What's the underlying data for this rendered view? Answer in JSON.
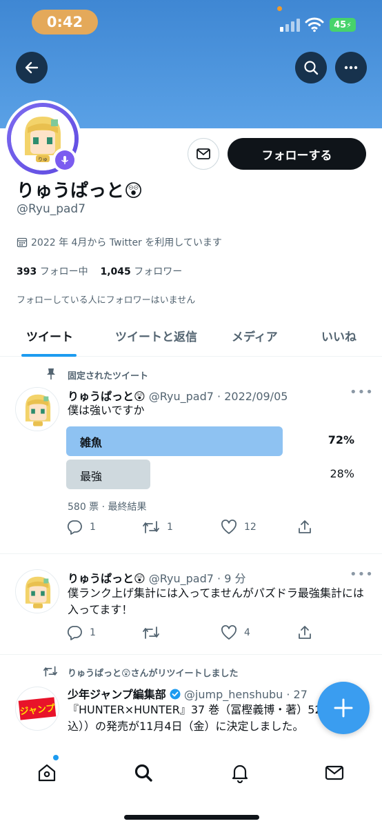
{
  "status": {
    "time": "0:42",
    "battery": "45"
  },
  "profile": {
    "display_name": "りゅうぱっと",
    "name_emoji": "😲",
    "handle": "@Ryu_pad7",
    "joined": "2022 年 4月から Twitter を利用しています",
    "following_count": "393",
    "following_label": "フォロー中",
    "followers_count": "1,045",
    "followers_label": "フォロワー",
    "followers_known": "フォローしている人にフォロワーはいません",
    "follow_label": "フォローする"
  },
  "tabs": [
    {
      "label": "ツイート"
    },
    {
      "label": "ツイートと返信"
    },
    {
      "label": "メディア"
    },
    {
      "label": "いいね"
    }
  ],
  "tweets": [
    {
      "context": "固定されたツイート",
      "name": "りゅうぱっと",
      "emoji": "😲",
      "handle": "@Ryu_pad7 · 2022/09/05",
      "text": "僕は強いですか",
      "poll": {
        "options": [
          {
            "label": "雑魚",
            "percent": "72%",
            "share": 72
          },
          {
            "label": "最強",
            "percent": "28%",
            "share": 28
          }
        ],
        "meta": "580 票 · 最終結果"
      },
      "replies": "1",
      "retweets": "1",
      "likes": "12"
    },
    {
      "name": "りゅうぱっと",
      "emoji": "😲",
      "handle": "@Ryu_pad7 · 9 分",
      "text": "僕ランク上げ集計には入ってませんがパズドラ最強集計には入ってます！",
      "replies": "1",
      "retweets": "",
      "likes": "4"
    },
    {
      "context": "りゅうぱっと😲さんがリツイートしました",
      "name": "少年ジャンプ編集部",
      "handle": "@jump_henshubu · 27",
      "avatar_text": "ジャンプ",
      "text": "『HUNTER×HUNTER』37 巻（冨樫義博・著）528円（税込））の発売が11月4日（金）に決定しました。"
    }
  ],
  "colors": {
    "accent": "#1d9bf0",
    "poll_winner": "#8ec2f2",
    "poll_other": "#cfd9de",
    "banner": "#4b92db"
  },
  "icons": [
    "back-arrow-icon",
    "search-icon",
    "more-icon",
    "mail-icon",
    "calendar-icon",
    "pin-icon",
    "retweet-icon",
    "reply-icon",
    "like-icon",
    "share-icon",
    "verified-icon",
    "home-icon",
    "bell-icon",
    "plus-icon"
  ]
}
